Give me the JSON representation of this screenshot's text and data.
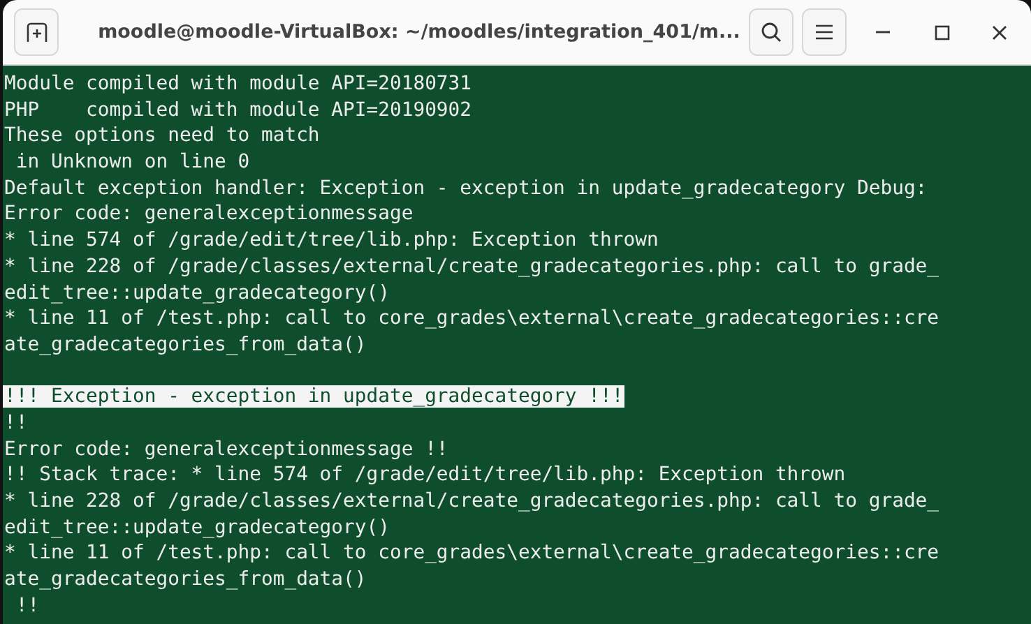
{
  "window": {
    "title": "moodle@moodle-VirtualBox: ~/moodles/integration_401/m..."
  },
  "terminal": {
    "blocks": [
      {
        "lines": [
          {
            "text": "Module compiled with module API=20180731",
            "highlighted": false
          },
          {
            "text": "PHP    compiled with module API=20190902",
            "highlighted": false
          },
          {
            "text": "These options need to match",
            "highlighted": false
          },
          {
            "text": " in Unknown on line 0",
            "highlighted": false
          },
          {
            "text": "Default exception handler: Exception - exception in update_gradecategory Debug:",
            "highlighted": false
          },
          {
            "text": "Error code: generalexceptionmessage",
            "highlighted": false
          },
          {
            "text": "* line 574 of /grade/edit/tree/lib.php: Exception thrown",
            "highlighted": false
          },
          {
            "text": "* line 228 of /grade/classes/external/create_gradecategories.php: call to grade_",
            "highlighted": false
          },
          {
            "text": "edit_tree::update_gradecategory()",
            "highlighted": false
          },
          {
            "text": "* line 11 of /test.php: call to core_grades\\external\\create_gradecategories::cre",
            "highlighted": false
          },
          {
            "text": "ate_gradecategories_from_data()",
            "highlighted": false
          }
        ]
      },
      {
        "lines": [
          {
            "text": "!!! Exception - exception in update_gradecategory !!!",
            "highlighted": true
          },
          {
            "text": "!!",
            "highlighted": false
          },
          {
            "text": "Error code: generalexceptionmessage !!",
            "highlighted": false
          },
          {
            "text": "!! Stack trace: * line 574 of /grade/edit/tree/lib.php: Exception thrown",
            "highlighted": false
          },
          {
            "text": "* line 228 of /grade/classes/external/create_gradecategories.php: call to grade_",
            "highlighted": false
          },
          {
            "text": "edit_tree::update_gradecategory()",
            "highlighted": false
          },
          {
            "text": "* line 11 of /test.php: call to core_grades\\external\\create_gradecategories::cre",
            "highlighted": false
          },
          {
            "text": "ate_gradecategories_from_data()",
            "highlighted": false
          },
          {
            "text": " !!",
            "highlighted": false
          }
        ]
      }
    ]
  }
}
